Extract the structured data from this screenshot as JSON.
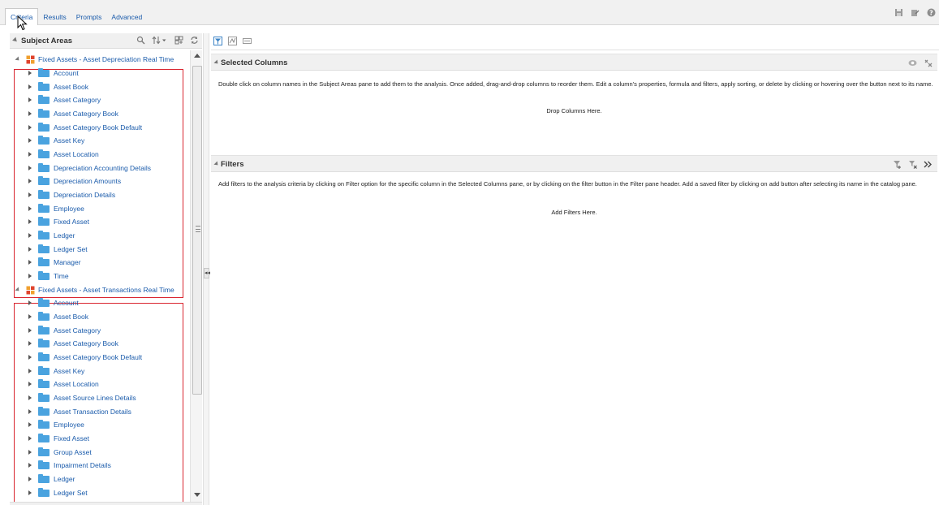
{
  "tabs": [
    {
      "label": "Criteria",
      "active": true
    },
    {
      "label": "Results",
      "active": false
    },
    {
      "label": "Prompts",
      "active": false
    },
    {
      "label": "Advanced",
      "active": false
    }
  ],
  "top_icons": [
    "save-icon",
    "save-as-icon",
    "help-icon"
  ],
  "subject_areas": {
    "title": "Subject Areas",
    "tools": [
      "search-icon",
      "sort-icon",
      "dropdown-arrow-icon",
      "add-subject-area-icon",
      "refresh-icon"
    ],
    "areas": [
      {
        "label": "Fixed Assets - Asset Depreciation Real Time",
        "folders": [
          "Account",
          "Asset Book",
          "Asset Category",
          "Asset Category Book",
          "Asset Category Book Default",
          "Asset Key",
          "Asset Location",
          "Depreciation Accounting Details",
          "Depreciation Amounts",
          "Depreciation Details",
          "Employee",
          "Fixed Asset",
          "Ledger",
          "Ledger Set",
          "Manager",
          "Time"
        ]
      },
      {
        "label": "Fixed Assets - Asset Transactions Real Time",
        "folders": [
          "Account",
          "Asset Book",
          "Asset Category",
          "Asset Category Book",
          "Asset Category Book Default",
          "Asset Key",
          "Asset Location",
          "Asset Source Lines Details",
          "Asset Transaction Details",
          "Employee",
          "Fixed Asset",
          "Group Asset",
          "Impairment Details",
          "Ledger",
          "Ledger Set"
        ]
      }
    ]
  },
  "right_toolbar_icons": [
    "filter-icon",
    "edit-formula-icon",
    "combine-icon"
  ],
  "selected_columns": {
    "title": "Selected Columns",
    "description": "Double click on column names in the Subject Areas pane to add them to the analysis. Once added, drag-and-drop columns to reorder them. Edit a column's properties, formula and filters, apply sorting, or delete by clicking or hovering over the button next to its name.",
    "drop_text": "Drop Columns Here."
  },
  "filters": {
    "title": "Filters",
    "description": "Add filters to the analysis criteria by clicking on Filter option for the specific column in the Selected Columns pane, or by clicking on the filter button in the Filter pane header. Add a saved filter by clicking on add button after selecting its name in the catalog pane.",
    "drop_text": "Add Filters Here."
  },
  "colors": {
    "link": "#1a5bab",
    "folder": "#4aa3df",
    "highlight_box": "#d9252f",
    "header_bg": "#f0f0f0"
  }
}
